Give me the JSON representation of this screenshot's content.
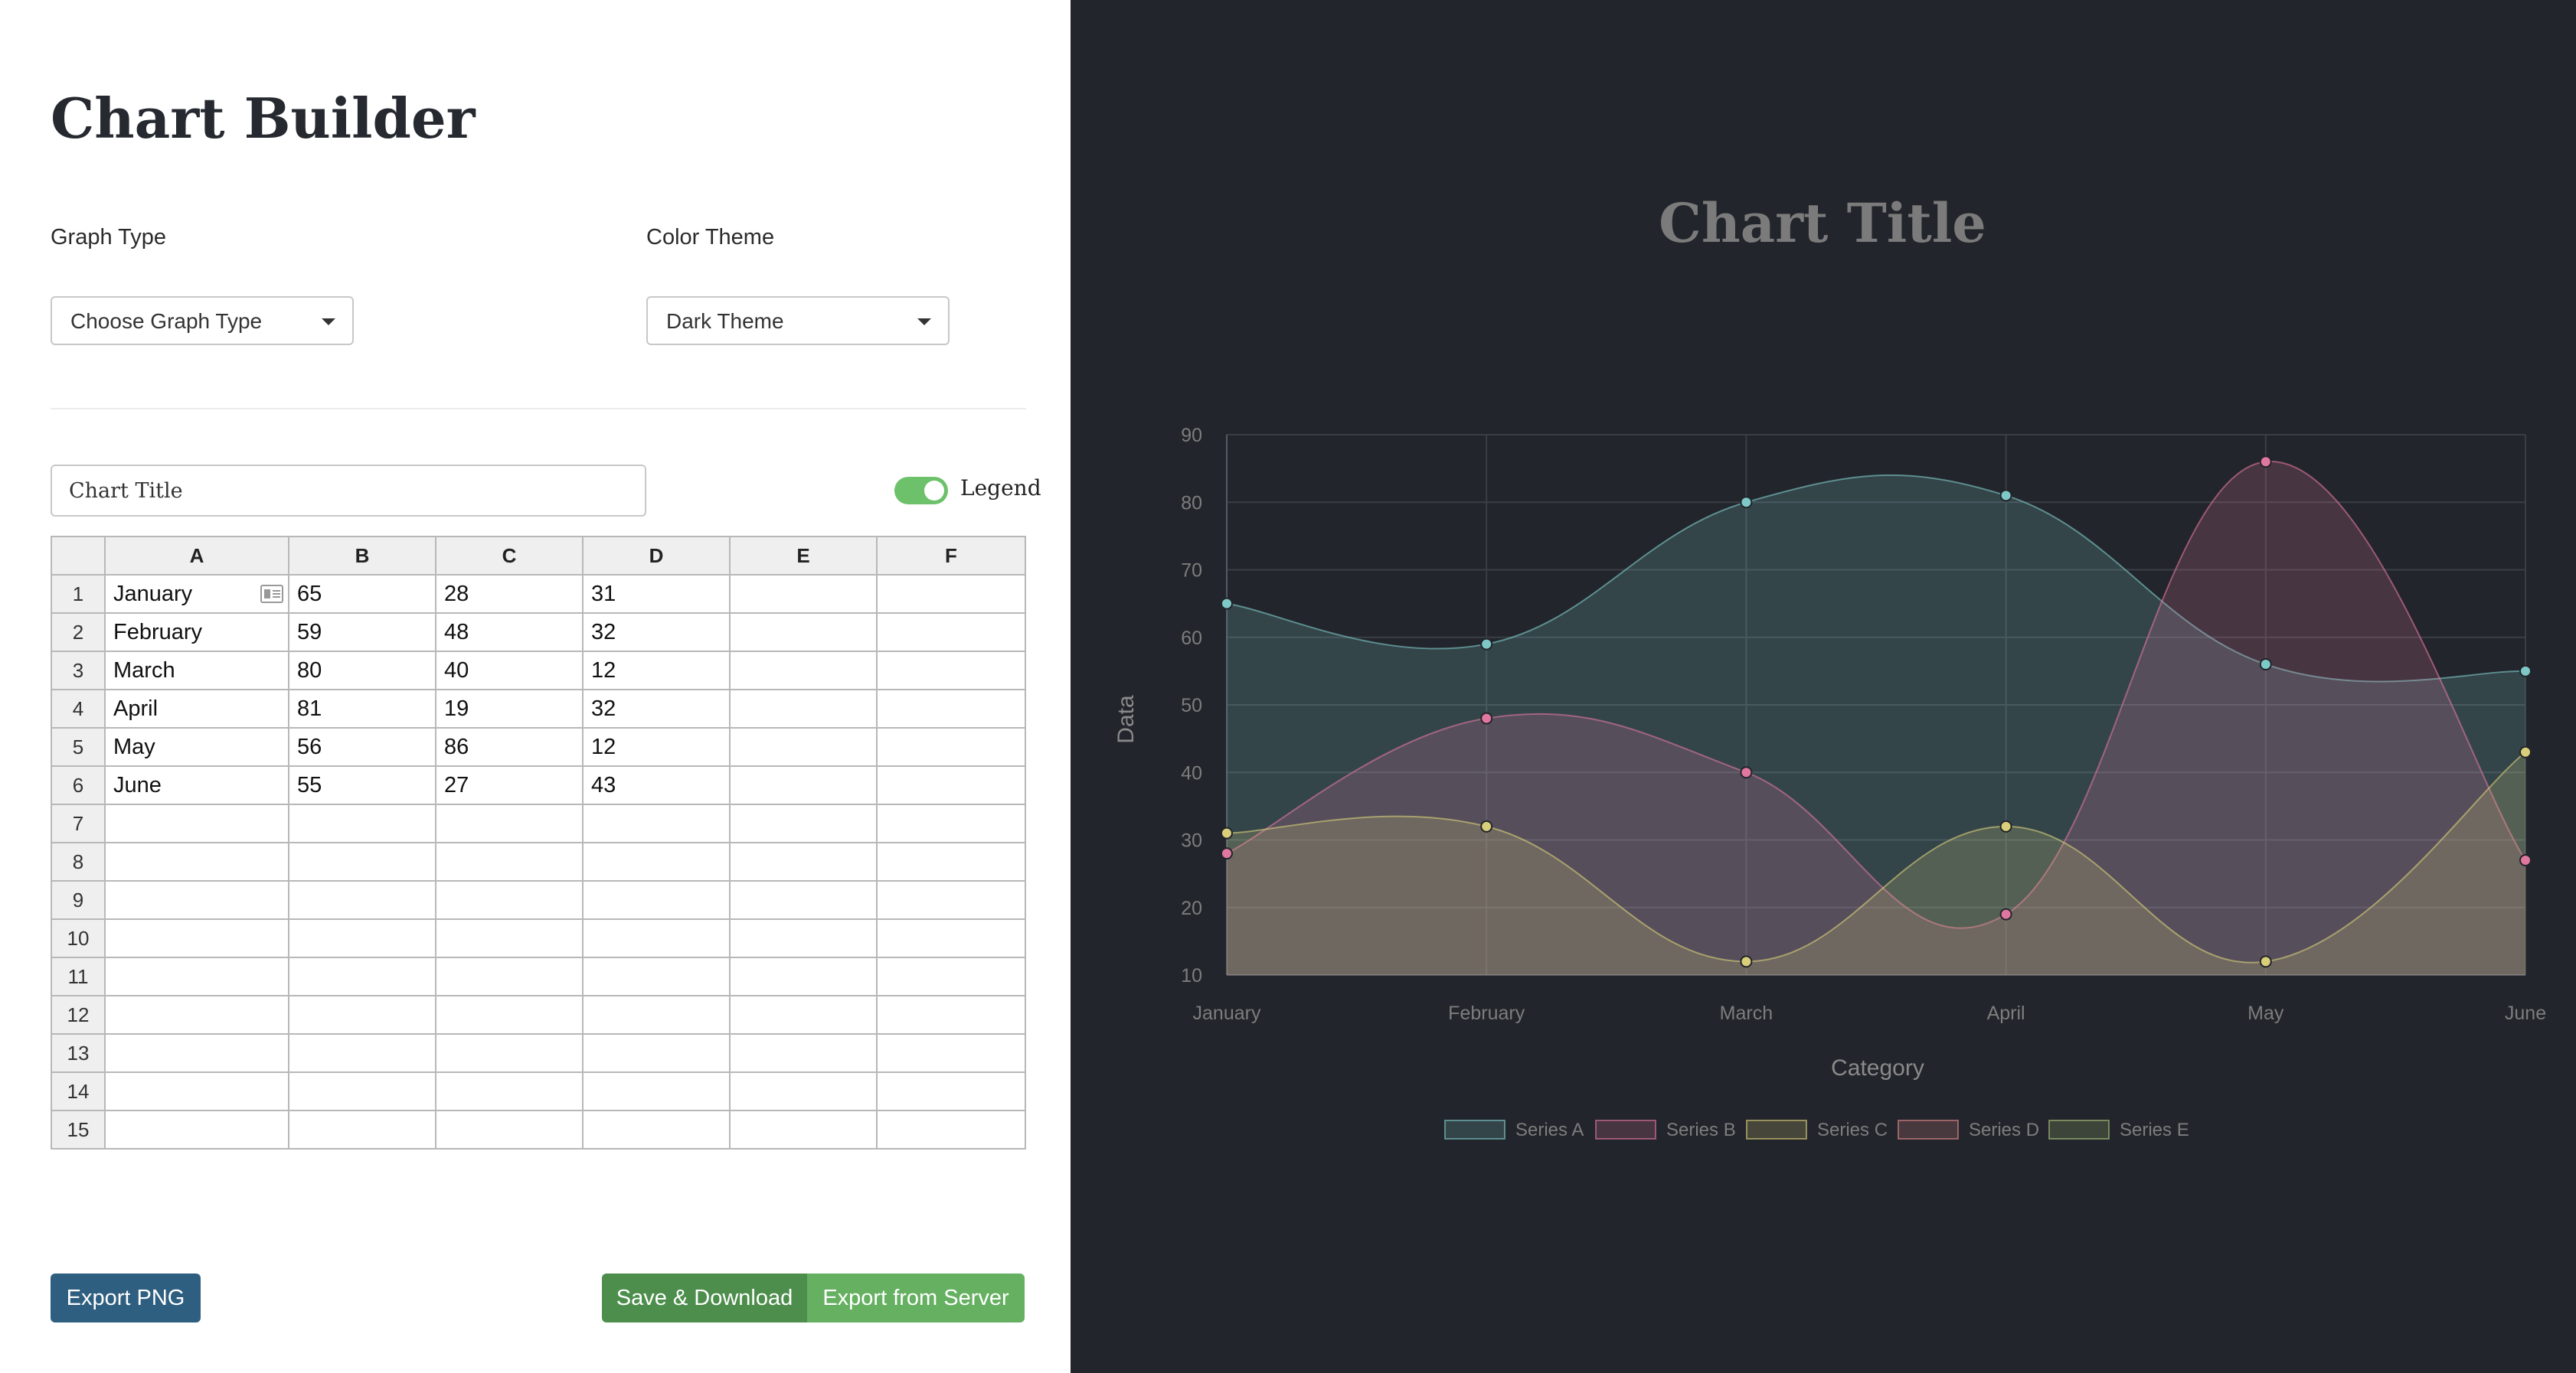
{
  "builder": {
    "title": "Chart Builder",
    "graph_type_label": "Graph Type",
    "graph_type_value": "Choose Graph Type",
    "color_theme_label": "Color Theme",
    "color_theme_value": "Dark Theme",
    "chart_title_input": "Chart Title",
    "legend_label": "Legend",
    "legend_on": true
  },
  "sheet": {
    "columns": [
      "A",
      "B",
      "C",
      "D",
      "E",
      "F"
    ],
    "rows": [
      [
        "1",
        "January",
        "65",
        "28",
        "31",
        "",
        ""
      ],
      [
        "2",
        "February",
        "59",
        "48",
        "32",
        "",
        ""
      ],
      [
        "3",
        "March",
        "80",
        "40",
        "12",
        "",
        ""
      ],
      [
        "4",
        "April",
        "81",
        "19",
        "32",
        "",
        ""
      ],
      [
        "5",
        "May",
        "56",
        "86",
        "12",
        "",
        ""
      ],
      [
        "6",
        "June",
        "55",
        "27",
        "43",
        "",
        ""
      ],
      [
        "7",
        "",
        "",
        "",
        "",
        "",
        ""
      ],
      [
        "8",
        "",
        "",
        "",
        "",
        "",
        ""
      ],
      [
        "9",
        "",
        "",
        "",
        "",
        "",
        ""
      ],
      [
        "10",
        "",
        "",
        "",
        "",
        "",
        ""
      ],
      [
        "11",
        "",
        "",
        "",
        "",
        "",
        ""
      ],
      [
        "12",
        "",
        "",
        "",
        "",
        "",
        ""
      ],
      [
        "13",
        "",
        "",
        "",
        "",
        "",
        ""
      ],
      [
        "14",
        "",
        "",
        "",
        "",
        "",
        ""
      ],
      [
        "15",
        "",
        "",
        "",
        "",
        "",
        ""
      ]
    ]
  },
  "buttons": {
    "export_png": "Export PNG",
    "save_download": "Save & Download",
    "export_server": "Export from Server"
  },
  "colors": {
    "panel_bg": "#22252b",
    "series_a": "#7ec9c8",
    "series_b": "#e0779f",
    "series_c": "#d9cf7a",
    "toggle_on": "#6cc16a",
    "export_png_btn": "#2f5f80",
    "save_btn": "#4d8e4c",
    "export_server_btn": "#65b061"
  },
  "chart_data": {
    "type": "area",
    "title": "Chart Title",
    "xlabel": "Category",
    "ylabel": "Data",
    "categories": [
      "January",
      "February",
      "March",
      "April",
      "May",
      "June"
    ],
    "ylim": [
      10,
      90
    ],
    "yticks": [
      "10",
      "20",
      "30",
      "40",
      "50",
      "60",
      "70",
      "80",
      "90"
    ],
    "grid": true,
    "legend_position": "bottom",
    "series": [
      {
        "name": "Series A",
        "values": [
          65,
          59,
          80,
          81,
          56,
          55
        ],
        "color": "#7ec9c8"
      },
      {
        "name": "Series B",
        "values": [
          28,
          48,
          40,
          19,
          86,
          27
        ],
        "color": "#e0779f"
      },
      {
        "name": "Series C",
        "values": [
          31,
          32,
          12,
          32,
          12,
          43
        ],
        "color": "#d9cf7a"
      }
    ],
    "legend": [
      {
        "name": "Series A",
        "color": "#7ec9c8"
      },
      {
        "name": "Series B",
        "color": "#e0779f"
      },
      {
        "name": "Series C",
        "color": "#d9cf7a"
      },
      {
        "name": "Series D",
        "color": "#e08a8a"
      },
      {
        "name": "Series E",
        "color": "#a8c27a"
      }
    ]
  }
}
